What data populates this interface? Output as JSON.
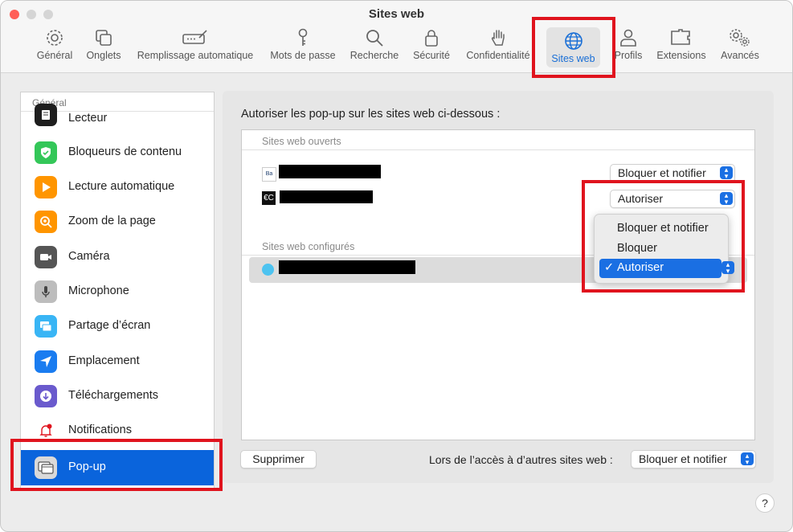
{
  "window": {
    "title": "Sites web"
  },
  "toolbar": {
    "items": [
      {
        "label": "Général",
        "icon": "gear-icon"
      },
      {
        "label": "Onglets",
        "icon": "tabs-icon"
      },
      {
        "label": "Remplissage automatique",
        "icon": "autofill-icon"
      },
      {
        "label": "Mots de passe",
        "icon": "key-icon"
      },
      {
        "label": "Recherche",
        "icon": "search-icon"
      },
      {
        "label": "Sécurité",
        "icon": "lock-icon"
      },
      {
        "label": "Confidentialité",
        "icon": "hand-icon"
      },
      {
        "label": "Sites web",
        "icon": "globe-icon",
        "active": true
      },
      {
        "label": "Profils",
        "icon": "person-icon"
      },
      {
        "label": "Extensions",
        "icon": "puzzle-icon"
      },
      {
        "label": "Avancés",
        "icon": "gears-icon"
      }
    ]
  },
  "sidebar": {
    "header": "Général",
    "items": [
      {
        "label": "Lecteur",
        "icon": "reader-icon"
      },
      {
        "label": "Bloqueurs de contenu",
        "icon": "shield-check-icon"
      },
      {
        "label": "Lecture automatique",
        "icon": "play-icon"
      },
      {
        "label": "Zoom de la page",
        "icon": "zoom-icon"
      },
      {
        "label": "Caméra",
        "icon": "camera-icon"
      },
      {
        "label": "Microphone",
        "icon": "microphone-icon"
      },
      {
        "label": "Partage d’écran",
        "icon": "screen-share-icon"
      },
      {
        "label": "Emplacement",
        "icon": "location-icon"
      },
      {
        "label": "Téléchargements",
        "icon": "download-icon"
      },
      {
        "label": "Notifications",
        "icon": "bell-icon"
      },
      {
        "label": "Pop-up",
        "icon": "popup-icon",
        "selected": true
      }
    ]
  },
  "main": {
    "title": "Autoriser les pop-up sur les sites web ci-dessous :",
    "open_header": "Sites web ouverts",
    "configured_header": "Sites web configurés",
    "open_sites": [
      {
        "favicon_text": "Ba",
        "setting": "Bloquer et notifier"
      },
      {
        "favicon_text": "€C",
        "setting": "Autoriser"
      }
    ],
    "configured_sites": [
      {
        "favicon_text": ""
      }
    ],
    "dropdown_menu": {
      "options": [
        "Bloquer et notifier",
        "Bloquer",
        "Autoriser"
      ],
      "selected": "Autoriser",
      "check_mark": "✓"
    },
    "delete_button": "Supprimer",
    "other_sites_label": "Lors de l’accès à d’autres sites web :",
    "other_sites_value": "Bloquer et notifier",
    "help_label": "?"
  },
  "colors": {
    "accent": "#1a6fe3",
    "selection": "#0a64dc",
    "highlight_box": "#e0141e"
  }
}
